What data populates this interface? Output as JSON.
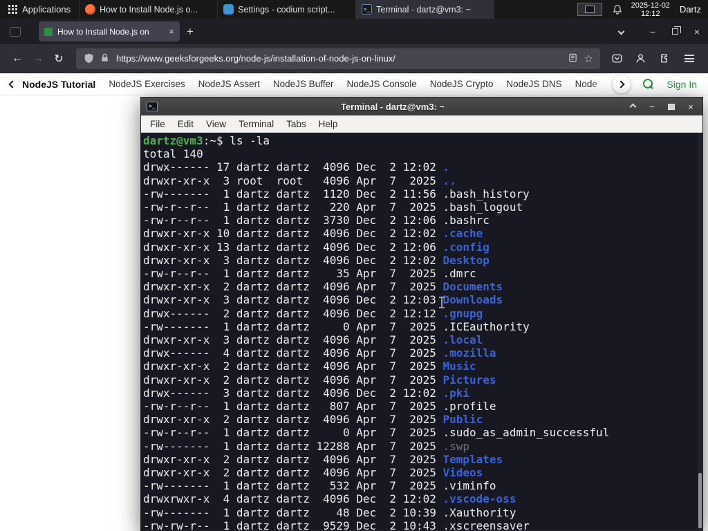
{
  "colors": {
    "gfg_green": "#2f8d46",
    "dir_blue": "#3b62d9",
    "prompt_green": "#4fae4f",
    "accent_orange": "#ff7139"
  },
  "icons": {
    "back": "←",
    "forward": "→",
    "reload": "↻",
    "star": "☆",
    "new_tab": "+",
    "close": "×",
    "minimize": "−",
    "chevron_left": "‹",
    "chevron_right": "›",
    "terminal_glyph": ">_"
  },
  "panel": {
    "applications": "Applications",
    "taskbar": [
      {
        "title": "How to Install Node.js o..."
      },
      {
        "title": "Settings - codium script..."
      },
      {
        "title": "Terminal - dartz@vm3: ~"
      }
    ],
    "date": "2025-12-02",
    "time": "12:12",
    "user": "Dartz"
  },
  "browser": {
    "tab": {
      "title": "How to Install Node.js on"
    },
    "url": "https://www.geeksforgeeks.org/node-js/installation-of-node-js-on-linux/",
    "nav": {
      "links": [
        "NodeJS Tutorial",
        "NodeJS Exercises",
        "NodeJS Assert",
        "NodeJS Buffer",
        "NodeJS Console",
        "NodeJS Crypto",
        "NodeJS DNS",
        "Node"
      ],
      "sign_in": "Sign In"
    }
  },
  "terminal": {
    "title": "Terminal - dartz@vm3: ~",
    "menus": [
      "File",
      "Edit",
      "View",
      "Terminal",
      "Tabs",
      "Help"
    ],
    "lines": [
      [
        [
          "dartz@vm3",
          "g"
        ],
        [
          ":~$ ",
          "w"
        ],
        [
          "ls -la",
          "w"
        ]
      ],
      [
        [
          "total 140",
          "w"
        ]
      ],
      [
        [
          "drwx------ 17 dartz dartz  4096 Dec  2 12:02 ",
          "w"
        ],
        [
          ".",
          "b"
        ]
      ],
      [
        [
          "drwxr-xr-x  3 root  root   4096 Apr  7  2025 ",
          "w"
        ],
        [
          "..",
          "b"
        ]
      ],
      [
        [
          "-rw-------  1 dartz dartz  1120 Dec  2 11:56 ",
          "w"
        ],
        [
          ".bash_history",
          "w"
        ]
      ],
      [
        [
          "-rw-r--r--  1 dartz dartz   220 Apr  7  2025 ",
          "w"
        ],
        [
          ".bash_logout",
          "w"
        ]
      ],
      [
        [
          "-rw-r--r--  1 dartz dartz  3730 Dec  2 12:06 ",
          "w"
        ],
        [
          ".bashrc",
          "w"
        ]
      ],
      [
        [
          "drwxr-xr-x 10 dartz dartz  4096 Dec  2 12:02 ",
          "w"
        ],
        [
          ".cache",
          "b"
        ]
      ],
      [
        [
          "drwxr-xr-x 13 dartz dartz  4096 Dec  2 12:06 ",
          "w"
        ],
        [
          ".config",
          "b"
        ]
      ],
      [
        [
          "drwxr-xr-x  3 dartz dartz  4096 Dec  2 12:02 ",
          "w"
        ],
        [
          "Desktop",
          "b"
        ]
      ],
      [
        [
          "-rw-r--r--  1 dartz dartz    35 Apr  7  2025 ",
          "w"
        ],
        [
          ".dmrc",
          "w"
        ]
      ],
      [
        [
          "drwxr-xr-x  2 dartz dartz  4096 Apr  7  2025 ",
          "w"
        ],
        [
          "Documents",
          "b"
        ]
      ],
      [
        [
          "drwxr-xr-x  3 dartz dartz  4096 Dec  2 12:03 ",
          "w"
        ],
        [
          "Downloads",
          "b"
        ]
      ],
      [
        [
          "drwx------  2 dartz dartz  4096 Dec  2 12:12 ",
          "w"
        ],
        [
          ".gnupg",
          "b"
        ]
      ],
      [
        [
          "-rw-------  1 dartz dartz     0 Apr  7  2025 ",
          "w"
        ],
        [
          ".ICEauthority",
          "w"
        ]
      ],
      [
        [
          "drwxr-xr-x  3 dartz dartz  4096 Apr  7  2025 ",
          "w"
        ],
        [
          ".local",
          "b"
        ]
      ],
      [
        [
          "drwx------  4 dartz dartz  4096 Apr  7  2025 ",
          "w"
        ],
        [
          ".mozilla",
          "b"
        ]
      ],
      [
        [
          "drwxr-xr-x  2 dartz dartz  4096 Apr  7  2025 ",
          "w"
        ],
        [
          "Music",
          "b"
        ]
      ],
      [
        [
          "drwxr-xr-x  2 dartz dartz  4096 Apr  7  2025 ",
          "w"
        ],
        [
          "Pictures",
          "b"
        ]
      ],
      [
        [
          "drwx------  3 dartz dartz  4096 Dec  2 12:02 ",
          "w"
        ],
        [
          ".pki",
          "b"
        ]
      ],
      [
        [
          "-rw-r--r--  1 dartz dartz   807 Apr  7  2025 ",
          "w"
        ],
        [
          ".profile",
          "w"
        ]
      ],
      [
        [
          "drwxr-xr-x  2 dartz dartz  4096 Apr  7  2025 ",
          "w"
        ],
        [
          "Public",
          "b"
        ]
      ],
      [
        [
          "-rw-r--r--  1 dartz dartz     0 Apr  7  2025 ",
          "w"
        ],
        [
          ".sudo_as_admin_successful",
          "w"
        ]
      ],
      [
        [
          "-rw-------  1 dartz dartz 12288 Apr  7  2025 ",
          "w"
        ],
        [
          ".swp",
          "x"
        ]
      ],
      [
        [
          "drwxr-xr-x  2 dartz dartz  4096 Apr  7  2025 ",
          "w"
        ],
        [
          "Templates",
          "b"
        ]
      ],
      [
        [
          "drwxr-xr-x  2 dartz dartz  4096 Apr  7  2025 ",
          "w"
        ],
        [
          "Videos",
          "b"
        ]
      ],
      [
        [
          "-rw-------  1 dartz dartz   532 Apr  7  2025 ",
          "w"
        ],
        [
          ".viminfo",
          "w"
        ]
      ],
      [
        [
          "drwxrwxr-x  4 dartz dartz  4096 Dec  2 12:02 ",
          "w"
        ],
        [
          ".vscode-oss",
          "b"
        ]
      ],
      [
        [
          "-rw-------  1 dartz dartz    48 Dec  2 10:39 ",
          "w"
        ],
        [
          ".Xauthority",
          "w"
        ]
      ],
      [
        [
          "-rw-rw-r--  1 dartz dartz  9529 Dec  2 10:43 ",
          "w"
        ],
        [
          ".xscreensaver",
          "w"
        ]
      ]
    ]
  }
}
